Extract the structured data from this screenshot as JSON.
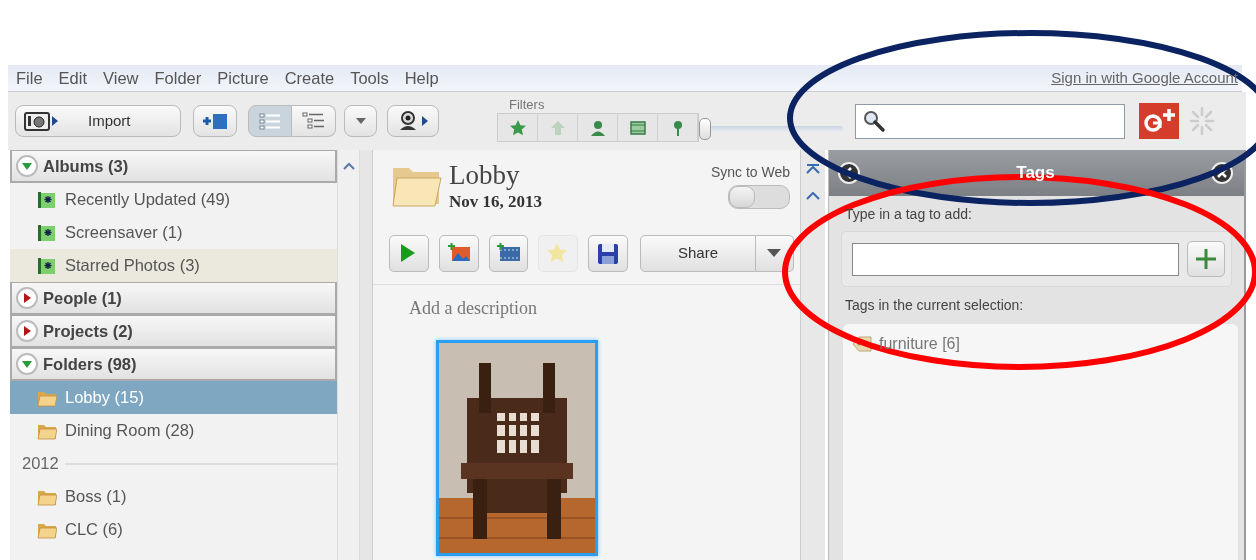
{
  "menu": {
    "items": [
      "File",
      "Edit",
      "View",
      "Folder",
      "Picture",
      "Create",
      "Tools",
      "Help"
    ],
    "sign_in": "Sign in with Google Account"
  },
  "toolbar": {
    "import": "Import",
    "views": [
      {
        "kind": "list",
        "selected": true
      },
      {
        "kind": "tree",
        "selected": false
      }
    ],
    "filters": {
      "label": "Filters",
      "buttons": [
        {
          "kind": "star",
          "disabled": false
        },
        {
          "kind": "upload",
          "disabled": true
        },
        {
          "kind": "people",
          "disabled": false
        },
        {
          "kind": "movie",
          "disabled": false
        },
        {
          "kind": "geotag",
          "disabled": false
        }
      ],
      "slider": {
        "level": 0
      }
    }
  },
  "sidebar": {
    "sections": [
      {
        "title": "Albums (3)",
        "expanded": true,
        "items": [
          {
            "kind": "album",
            "label": "Recently Updated (49)",
            "selected": false,
            "hovered": false
          },
          {
            "kind": "album",
            "label": "Screensaver (1)",
            "selected": false,
            "hovered": false
          },
          {
            "kind": "album",
            "label": "Starred Photos (3)",
            "selected": false,
            "hovered": true
          }
        ]
      },
      {
        "title": "People (1)",
        "expanded": false
      },
      {
        "title": "Projects (2)",
        "expanded": false
      },
      {
        "title": "Folders (98)",
        "expanded": true,
        "items": [
          {
            "kind": "folder",
            "label": "Lobby (15)",
            "selected": true,
            "hovered": false
          },
          {
            "kind": "folder",
            "label": "Dining Room (28)",
            "selected": false,
            "hovered": false
          },
          {
            "kind": "year",
            "label": "2012",
            "selected": false,
            "hovered": false
          },
          {
            "kind": "folder",
            "label": "Boss (1)",
            "selected": false,
            "hovered": false
          },
          {
            "kind": "folder",
            "label": "CLC (6)",
            "selected": false,
            "hovered": false
          }
        ]
      }
    ]
  },
  "album": {
    "title": "Lobby",
    "date": "Nov 16, 2013",
    "sync": {
      "label": "Sync to Web",
      "on": false
    },
    "actions": [
      {
        "kind": "play",
        "disabled": false
      },
      {
        "kind": "add-photo",
        "disabled": false
      },
      {
        "kind": "add-movie",
        "disabled": false
      },
      {
        "kind": "star",
        "disabled": true
      },
      {
        "kind": "save",
        "disabled": false
      }
    ],
    "share": "Share",
    "description_prompt": "Add a description",
    "photos": [
      {
        "kind": "picture",
        "selected": true
      }
    ]
  },
  "tags": {
    "title": "Tags",
    "add_label": "Type in a tag to add:",
    "current_label": "Tags in the current selection:",
    "list": [
      {
        "label": "furniture [6]"
      }
    ]
  },
  "annotations": [
    {
      "color": "#0b2361"
    },
    {
      "color": "#ff0000"
    }
  ]
}
